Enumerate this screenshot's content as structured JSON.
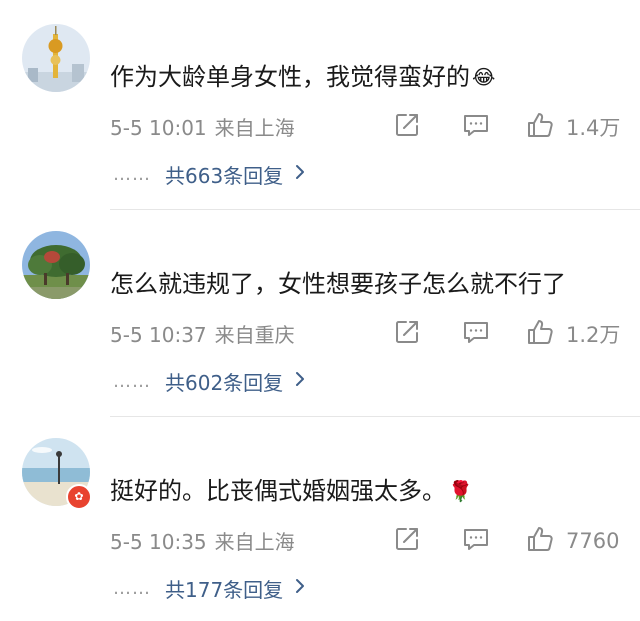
{
  "comments": [
    {
      "text": "作为大龄单身女性，我觉得蛮好的",
      "emoji": "😂",
      "time": "5-5 10:01",
      "location": "来自上海",
      "likes": "1.4万",
      "replies": "共663条回复",
      "dots": "……"
    },
    {
      "text": "怎么就违规了，女性想要孩子怎么就不行了",
      "emoji": "",
      "time": "5-5 10:37",
      "location": "来自重庆",
      "likes": "1.2万",
      "replies": "共602条回复",
      "dots": "……"
    },
    {
      "text": "挺好的。比丧偶式婚姻强太多。",
      "emoji": "🌹",
      "time": "5-5 10:35",
      "location": "来自上海",
      "likes": "7760",
      "replies": "共177条回复",
      "dots": "……"
    }
  ],
  "icons": {
    "share": "share-icon",
    "reply": "comment-icon",
    "like": "thumbs-up-icon",
    "chevron": "chevron-right-icon"
  },
  "colors": {
    "link": "#3f5f89",
    "meta": "#8a8a8a",
    "text": "#1a1a1a",
    "badge": "#e8432f"
  }
}
